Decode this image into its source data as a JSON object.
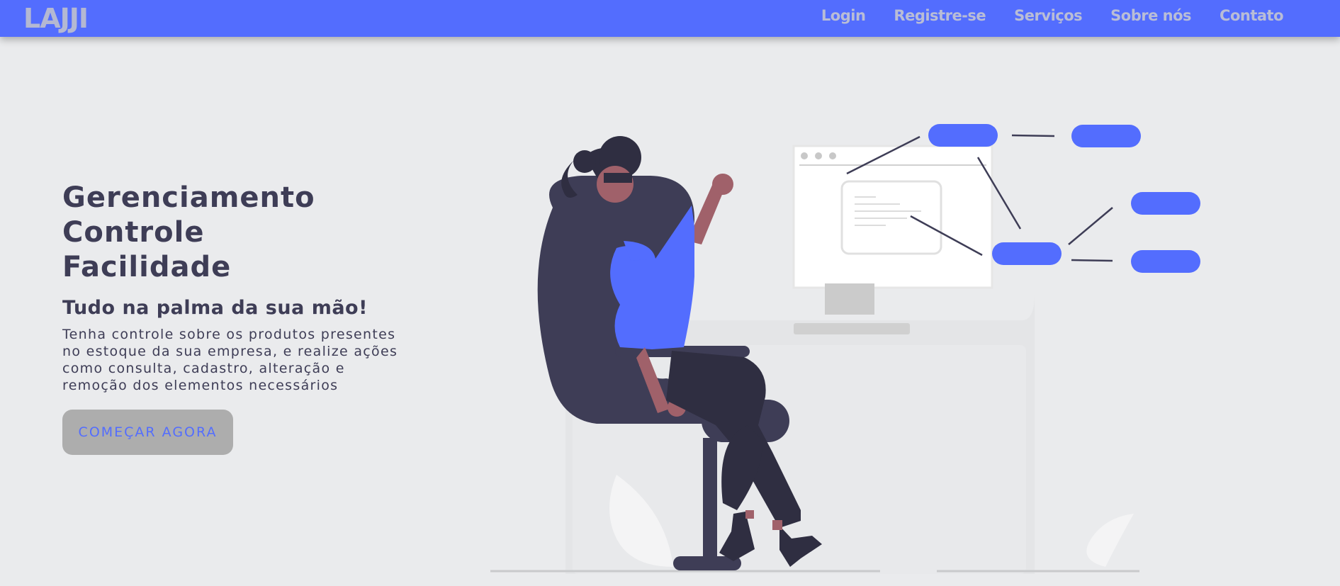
{
  "navbar": {
    "brand": "LAJJI",
    "links": [
      {
        "label": "Login"
      },
      {
        "label": "Registre-se"
      },
      {
        "label": "Serviços"
      },
      {
        "label": "Sobre nós"
      },
      {
        "label": "Contato"
      }
    ]
  },
  "hero": {
    "headline": [
      "Gerenciamento",
      "Controle",
      "Facilidade"
    ],
    "subtitle": "Tudo na palma da sua mão!",
    "description": "Tenha controle sobre os produtos presentes no estoque da sua empresa, e realize ações como consulta, cadastro, alteração e remoção dos elementos necessários",
    "cta_label": "COMEÇAR AGORA"
  },
  "colors": {
    "accent": "#536dfe",
    "background": "#eaebed",
    "text": "#3e3d56",
    "button_bg": "#adadad"
  },
  "illustration": {
    "name": "woman-at-desk-network-illustration"
  }
}
